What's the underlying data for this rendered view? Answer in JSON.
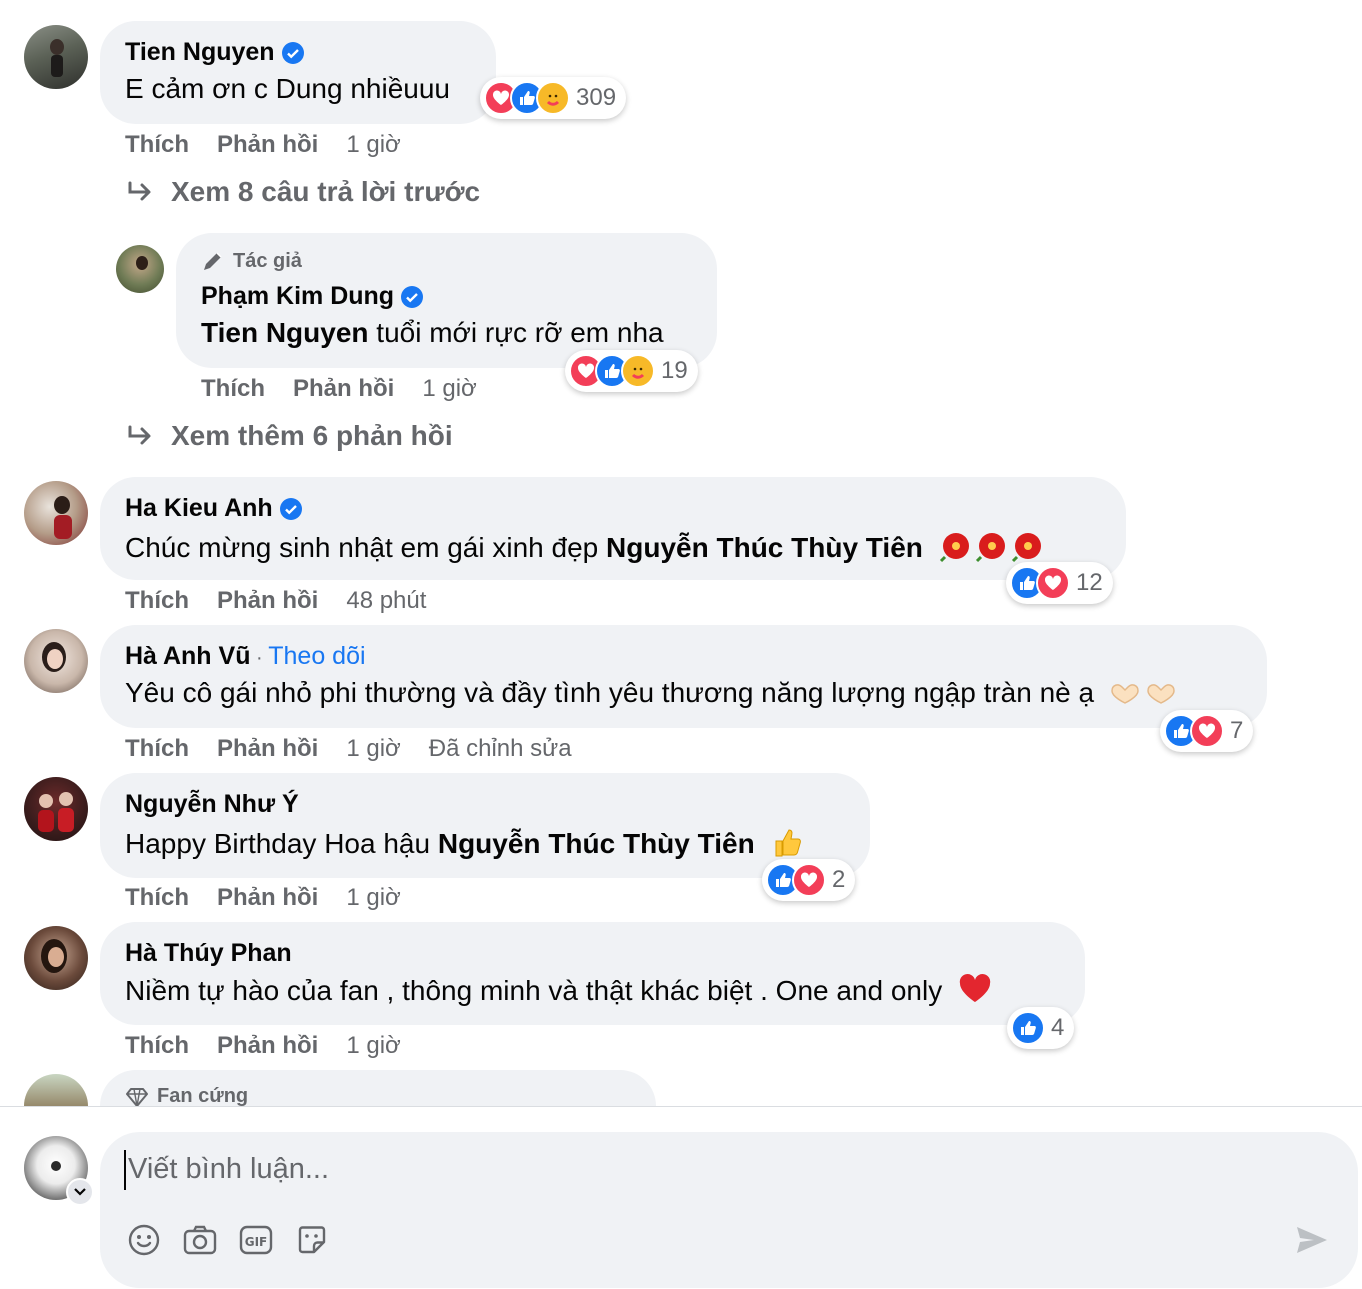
{
  "comments": [
    {
      "name": "Tien Nguyen",
      "text": "E cảm ơn c Dung nhiềuuu",
      "reactions_count": "309",
      "actions": {
        "like": "Thích",
        "reply": "Phản hồi",
        "time": "1 giờ"
      }
    },
    {
      "view_previous": "Xem 8 câu trả lời trước"
    },
    {
      "badge": "Tác giả",
      "name": "Phạm Kim Dung",
      "mention": "Tien Nguyen",
      "text": " tuổi mới rực rỡ em nha",
      "reactions_count": "19",
      "actions": {
        "like": "Thích",
        "reply": "Phản hồi",
        "time": "1 giờ"
      }
    },
    {
      "view_more": "Xem thêm 6 phản hồi"
    },
    {
      "name": "Ha Kieu Anh",
      "text": "Chúc mừng sinh nhật em gái xinh đẹp ",
      "mention": "Nguyễn Thúc Thùy Tiên",
      "reactions_count": "12",
      "actions": {
        "like": "Thích",
        "reply": "Phản hồi",
        "time": "48 phút"
      }
    },
    {
      "name": "Hà Anh Vũ",
      "separator": " · ",
      "follow": "Theo dõi",
      "text": "Yêu cô gái nhỏ phi thường và đầy tình yêu thương năng lượng ngập tràn nè ạ",
      "reactions_count": "7",
      "actions": {
        "like": "Thích",
        "reply": "Phản hồi",
        "time": "1 giờ",
        "edited": "Đã chỉnh sửa"
      }
    },
    {
      "name": "Nguyễn Như Ý",
      "text": "Happy Birthday Hoa hậu ",
      "mention": "Nguyễn Thúc Thùy Tiên",
      "reactions_count": "2",
      "actions": {
        "like": "Thích",
        "reply": "Phản hồi",
        "time": "1 giờ"
      }
    },
    {
      "name": "Hà Thúy Phan",
      "text": "Niềm tự hào của fan , thông minh và thật khác biệt . One and only",
      "reactions_count": "4",
      "actions": {
        "like": "Thích",
        "reply": "Phản hồi",
        "time": "1 giờ"
      }
    },
    {
      "badge": "Fan cứng"
    }
  ],
  "composer": {
    "placeholder": "Viết bình luận...",
    "tools": [
      "emoji-icon",
      "camera-icon",
      "gif-icon",
      "sticker-icon"
    ],
    "send": "send-icon"
  },
  "colors": {
    "bubble": "#f0f2f5",
    "secondary_text": "#65676b",
    "link": "#1877f2",
    "like": "#1877f2",
    "love": "#f33e58"
  }
}
